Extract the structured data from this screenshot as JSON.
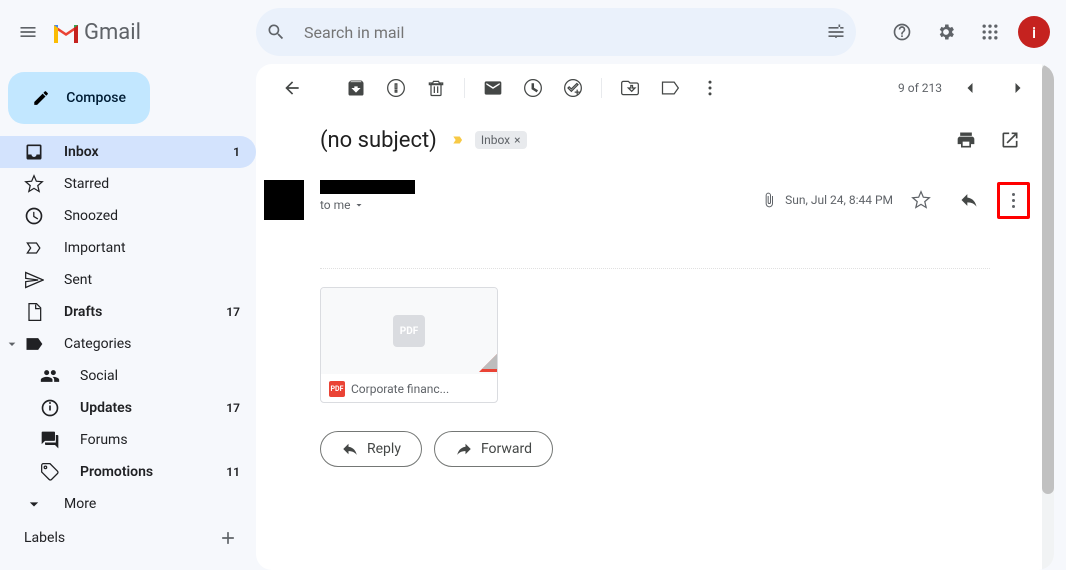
{
  "header": {
    "app_name": "Gmail",
    "search_placeholder": "Search in mail",
    "avatar_initial": "i"
  },
  "sidebar": {
    "compose": "Compose",
    "items": [
      {
        "label": "Inbox",
        "count": "1"
      },
      {
        "label": "Starred"
      },
      {
        "label": "Snoozed"
      },
      {
        "label": "Important"
      },
      {
        "label": "Sent"
      },
      {
        "label": "Drafts",
        "count": "17"
      },
      {
        "label": "Categories"
      },
      {
        "label": "Social"
      },
      {
        "label": "Updates",
        "count": "17"
      },
      {
        "label": "Forums"
      },
      {
        "label": "Promotions",
        "count": "11"
      },
      {
        "label": "More"
      }
    ],
    "labels_header": "Labels"
  },
  "toolbar": {
    "position": "9 of 213"
  },
  "message": {
    "subject": "(no subject)",
    "chip": "Inbox",
    "to": "to me",
    "date": "Sun, Jul 24, 8:44 PM"
  },
  "attachment": {
    "placeholder": "PDF",
    "badge": "PDF",
    "name": "Corporate financ..."
  },
  "actions": {
    "reply": "Reply",
    "forward": "Forward"
  }
}
